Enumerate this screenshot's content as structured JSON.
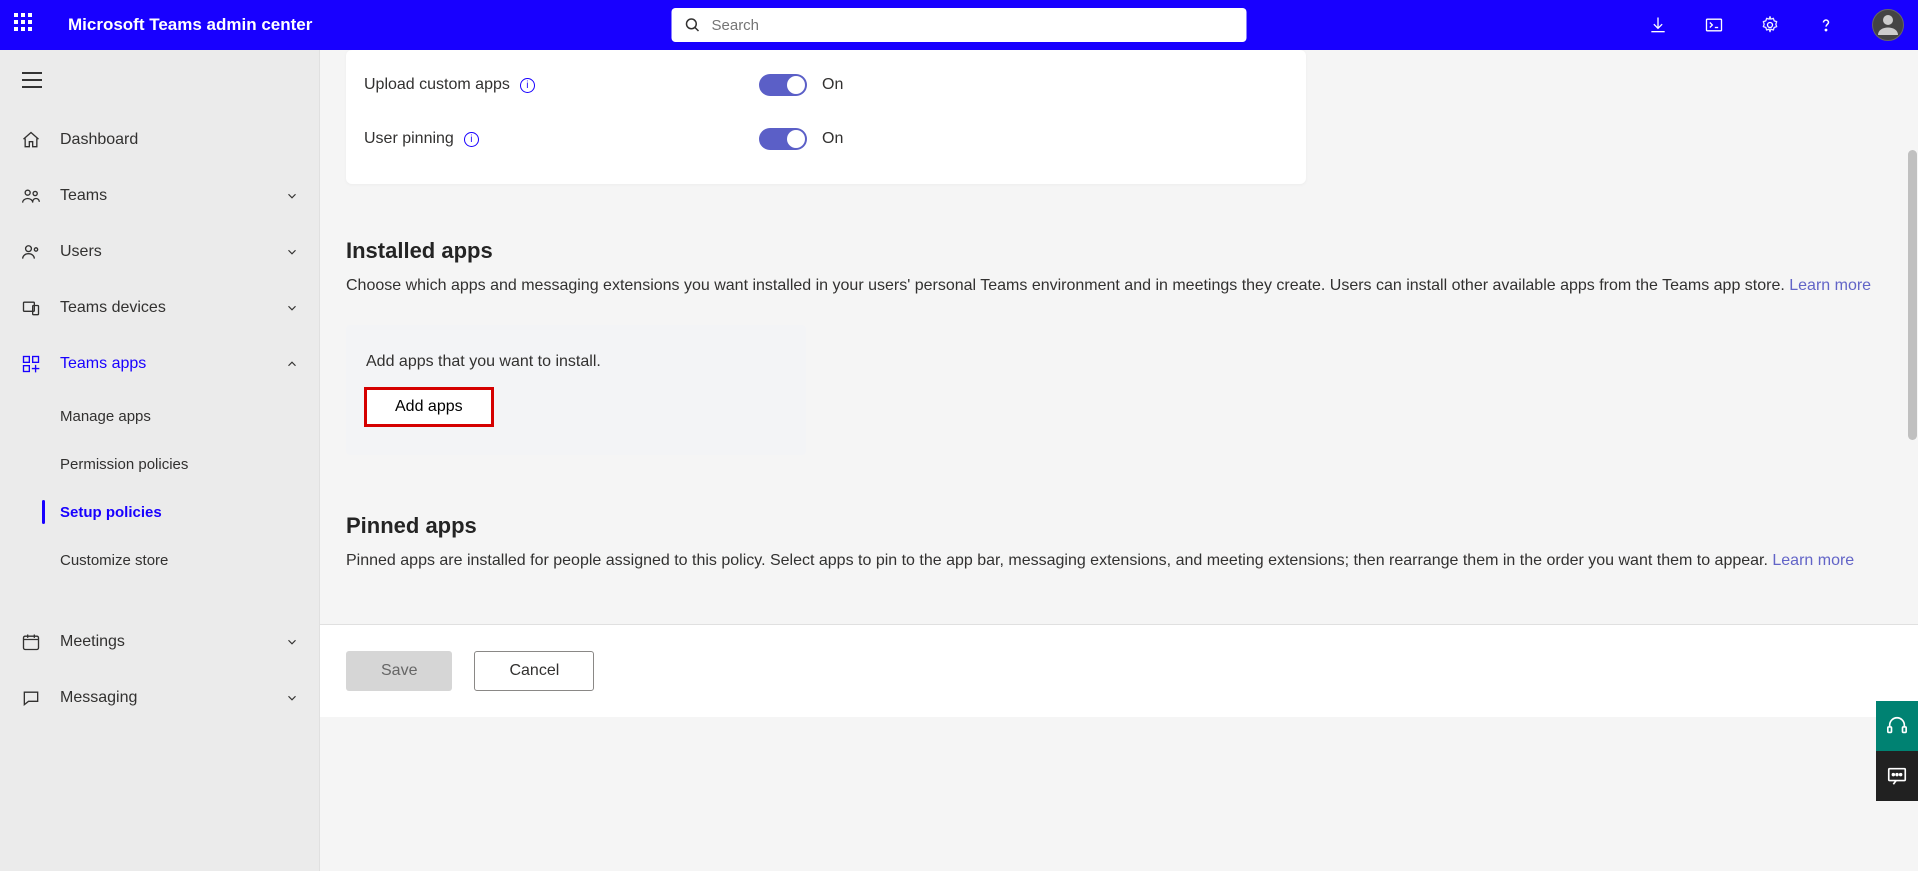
{
  "header": {
    "brand": "Microsoft Teams admin center",
    "search_placeholder": "Search"
  },
  "sidebar": {
    "items": [
      {
        "id": "dashboard",
        "label": "Dashboard",
        "icon": "home",
        "expandable": false
      },
      {
        "id": "teams",
        "label": "Teams",
        "icon": "people",
        "expandable": true,
        "expanded": false
      },
      {
        "id": "users",
        "label": "Users",
        "icon": "user",
        "expandable": true,
        "expanded": false
      },
      {
        "id": "devices",
        "label": "Teams devices",
        "icon": "devices",
        "expandable": true,
        "expanded": false
      },
      {
        "id": "apps",
        "label": "Teams apps",
        "icon": "apps",
        "expandable": true,
        "expanded": true,
        "children": [
          {
            "id": "manage-apps",
            "label": "Manage apps",
            "active": false
          },
          {
            "id": "permission-policies",
            "label": "Permission policies",
            "active": false
          },
          {
            "id": "setup-policies",
            "label": "Setup policies",
            "active": true
          },
          {
            "id": "customize-store",
            "label": "Customize store",
            "active": false
          }
        ]
      },
      {
        "id": "meetings",
        "label": "Meetings",
        "icon": "calendar",
        "expandable": true,
        "expanded": false
      },
      {
        "id": "messaging",
        "label": "Messaging",
        "icon": "chat",
        "expandable": true,
        "expanded": false
      }
    ]
  },
  "settings_card": {
    "rows": [
      {
        "label": "Upload custom apps",
        "state": "On"
      },
      {
        "label": "User pinning",
        "state": "On"
      }
    ]
  },
  "installed_section": {
    "title": "Installed apps",
    "description_pre_link": "Choose which apps and messaging extensions you want installed in your users' personal Teams environment and in meetings they create. Users can install other available apps from the Teams app store. ",
    "learn_more": "Learn more",
    "box_text": "Add apps that you want to install.",
    "add_button": "Add apps"
  },
  "pinned_section": {
    "title": "Pinned apps",
    "description_pre_link": "Pinned apps are installed for people assigned to this policy. Select apps to pin to the app bar, messaging extensions, and meeting extensions; then rearrange them in the order you want them to appear. ",
    "learn_more": "Learn more"
  },
  "footer": {
    "save": "Save",
    "cancel": "Cancel"
  }
}
